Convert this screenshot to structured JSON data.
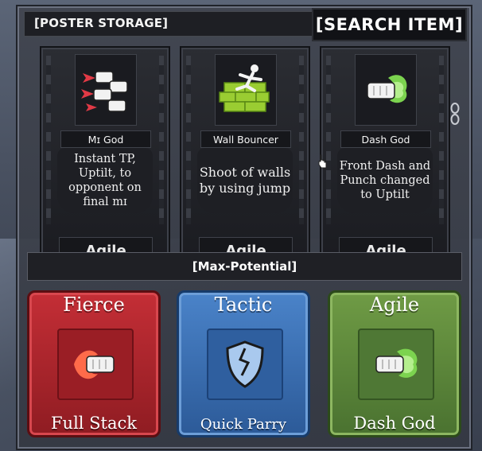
{
  "header": {
    "title": "[POSTER STORAGE]",
    "search_label": "[SEARCH ITEM]"
  },
  "cards": [
    {
      "name": "Mɪ God",
      "desc": "Instant TP, Uptilt, to opponent on final mɪ",
      "type": "Agile",
      "icon": "multi-punch-icon"
    },
    {
      "name": "Wall Bouncer",
      "desc": "Shoot of walls by using jump",
      "type": "Agile",
      "icon": "wall-jump-icon"
    },
    {
      "name": "Dash God",
      "desc": "Front Dash and Punch changed to Uptilt",
      "type": "Agile",
      "icon": "dash-punch-icon"
    }
  ],
  "max_potential": {
    "label": "[Max-Potential]"
  },
  "slots": [
    {
      "category": "Fierce",
      "move": "Full Stack",
      "color": "#b3262d",
      "icon": "fire-fist-icon"
    },
    {
      "category": "Tactic",
      "move": "Quick Parry",
      "color": "#3a6fb5",
      "icon": "cracked-shield-icon"
    },
    {
      "category": "Agile",
      "move": "Dash God",
      "color": "#5e8a3a",
      "icon": "dash-punch-icon"
    }
  ],
  "colors": {
    "panel": "#40444e",
    "fierce": "#b3262d",
    "tactic": "#3a6fb5",
    "agile": "#5e8a3a",
    "dash_green": "#7cd34f"
  }
}
